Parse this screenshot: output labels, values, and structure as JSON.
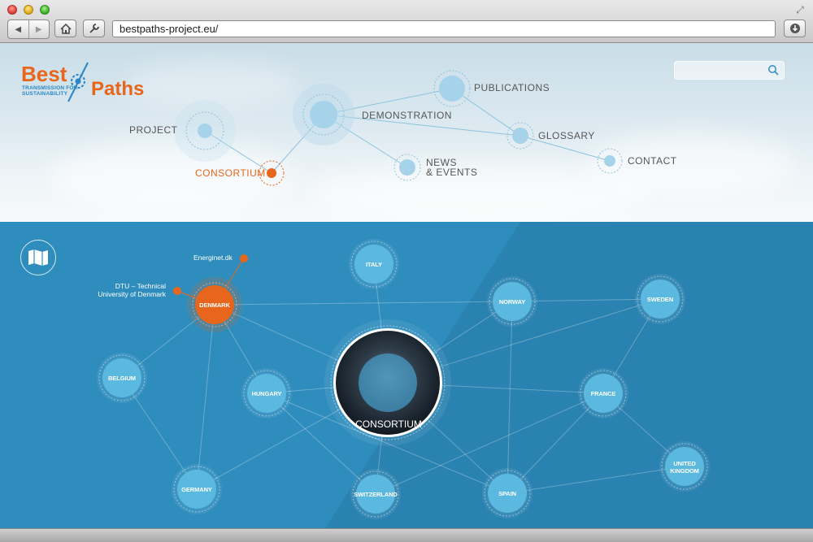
{
  "browser": {
    "url": "bestpaths-project.eu/",
    "back_icon": "chevron-left-icon",
    "forward_icon": "chevron-right-icon"
  },
  "logo": {
    "best": "Best",
    "paths": "Paths",
    "tagline_line1": "TRANSMISSION FOR",
    "tagline_line2": "SUSTAINABILITY"
  },
  "search": {
    "placeholder": ""
  },
  "nav": {
    "project": "PROJECT",
    "consortium": "CONSORTIUM",
    "demonstration": "DEMONSTRATION",
    "news_line1": "NEWS",
    "news_line2": "& EVENTS",
    "publications": "PUBLICATIONS",
    "glossary": "GLOSSARY",
    "contact": "CONTACT"
  },
  "colors": {
    "accent": "#e8661b",
    "blue_bg": "#2f8dbd",
    "node_fill": "#5bb8df"
  },
  "network": {
    "center": "CONSORTIUM",
    "countries": {
      "italy": "ITALY",
      "denmark": "DENMARK",
      "norway": "NORWAY",
      "sweden": "SWEDEN",
      "belgium": "BELGIUM",
      "hungary": "HUNGARY",
      "france": "FRANCE",
      "germany": "GERMANY",
      "switzerland": "SWITZERLAND",
      "spain": "SPAIN",
      "uk_line1": "UNITED",
      "uk_line2": "KINGDOM"
    },
    "partners": {
      "energinet": "Energinet.dk",
      "dtu_line1": "DTU – Technical",
      "dtu_line2": "University of Denmark"
    }
  }
}
